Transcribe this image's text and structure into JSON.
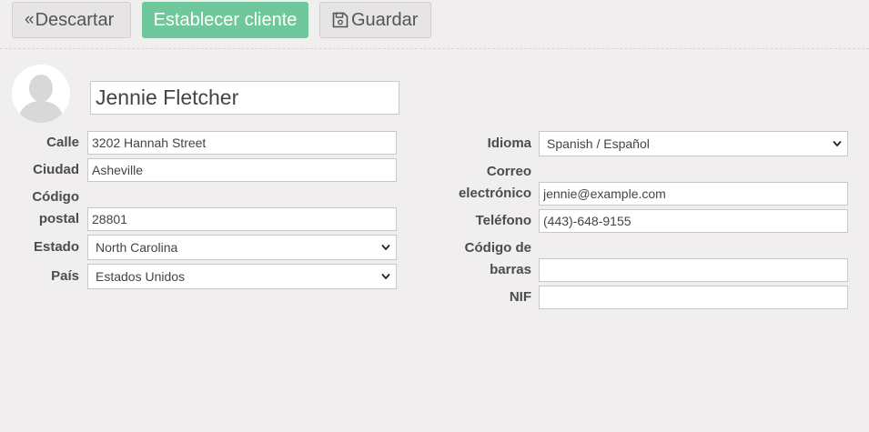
{
  "toolbar": {
    "discard_icon": "«",
    "discard_label": "Descartar",
    "set_customer_label": "Establecer cliente",
    "save_label": "Guardar"
  },
  "customer": {
    "name": "Jennie Fletcher"
  },
  "address": {
    "street_label": "Calle",
    "street_value": "3202 Hannah Street",
    "city_label": "Ciudad",
    "city_value": "Asheville",
    "zip_label_line1": "Código",
    "zip_label_line2": "postal",
    "zip_value": "28801",
    "state_label": "Estado",
    "state_value": "North Carolina",
    "country_label": "País",
    "country_value": "Estados Unidos"
  },
  "contact": {
    "language_label": "Idioma",
    "language_value": "Spanish / Español",
    "email_label_line1": "Correo",
    "email_label_line2": "electrónico",
    "email_value": "jennie@example.com",
    "phone_label": "Teléfono",
    "phone_value": "(443)-648-9155",
    "barcode_label_line1": "Código de",
    "barcode_label_line2": "barras",
    "barcode_value": "",
    "vat_label": "NIF",
    "vat_value": ""
  },
  "colors": {
    "background": "#f0eeee",
    "accent_button": "#6ec89b",
    "text": "#4c4c4c"
  }
}
